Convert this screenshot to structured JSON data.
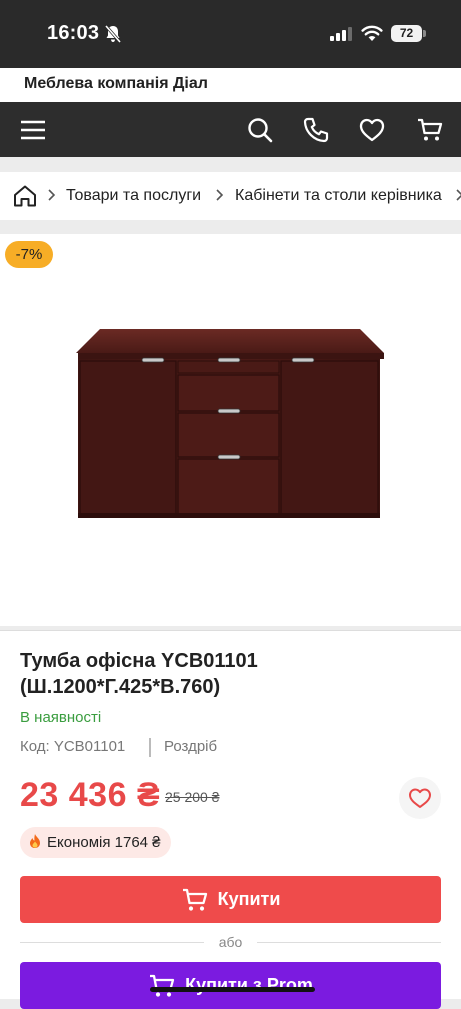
{
  "status_bar": {
    "time": "16:03",
    "battery": "72"
  },
  "header": {
    "company_name": "Меблева компанія Діал"
  },
  "navbar": {
    "icons": [
      "menu-icon",
      "search-icon",
      "phone-icon",
      "heart-icon",
      "cart-icon"
    ]
  },
  "breadcrumbs": {
    "items": [
      "Товари та послуги",
      "Кабінети та столи керівника"
    ]
  },
  "product": {
    "discount_badge": "-7%",
    "title": "Тумба офісна YCB01101 (Ш.1200*Г.425*В.760)",
    "stock_status": "В наявності",
    "sku": "Код: YCB01101",
    "sale_type": "Роздріб",
    "price": "23 436 ₴",
    "old_price": "25 200 ₴",
    "savings": "Економія 1764 ₴"
  },
  "actions": {
    "buy_label": "Купити",
    "or_label": "або",
    "prom_label": "Купити з Prom"
  },
  "colors": {
    "accent_red": "#ef4b4b",
    "price_red": "#e84949",
    "prom_purple": "#7b1be0",
    "stock_green": "#3a9d3f",
    "badge_orange": "#f7ad26"
  }
}
